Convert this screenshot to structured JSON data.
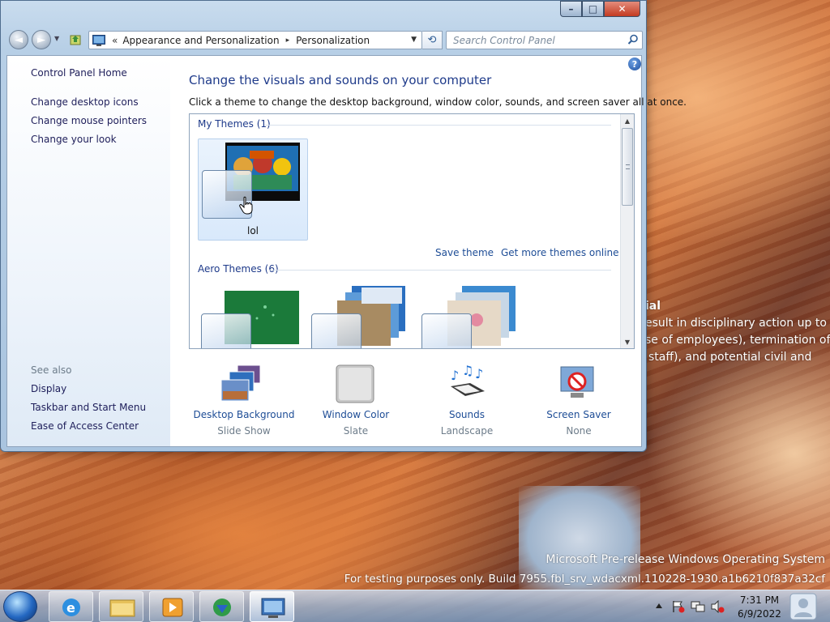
{
  "desktop": {
    "overlay_text": {
      "line1": "ial",
      "line2": "esult in disciplinary action up to",
      "line3": "se of employees), termination of",
      "line4": "staff), and potential civil and"
    },
    "watermark": {
      "line1": "Microsoft Pre-release Windows Operating System",
      "line2": "For testing purposes only. Build 7955.fbl_srv_wdacxml.110228-1930.a1b6210f837a32cf"
    }
  },
  "window": {
    "caption_buttons": {
      "minimize": "–",
      "maximize": "□",
      "close": "✕"
    },
    "nav": {
      "back": "◄",
      "forward": "►",
      "address": {
        "chevron": "«",
        "crumb1": "Appearance and Personalization",
        "separator": "▸",
        "crumb2": "Personalization",
        "dropdown": "▼"
      },
      "refresh": "⟲",
      "search": {
        "placeholder": "Search Control Panel"
      }
    },
    "left_pane": {
      "home": "Control Panel Home",
      "links": [
        "Change desktop icons",
        "Change mouse pointers",
        "Change your look"
      ],
      "see_also_label": "See also",
      "see_also": [
        "Display",
        "Taskbar and Start Menu",
        "Ease of Access Center"
      ]
    },
    "help": "?",
    "main": {
      "title": "Change the visuals and sounds on your computer",
      "subtitle": "Click a theme to change the desktop background, window color, sounds, and screen saver all at once.",
      "my_themes_header": "My Themes (1)",
      "my_theme_name": "lol",
      "save_theme": "Save theme",
      "get_more_themes": "Get more themes online",
      "aero_themes_header": "Aero Themes (6)"
    },
    "bottom": [
      {
        "label": "Desktop Background",
        "value": "Slide Show"
      },
      {
        "label": "Window Color",
        "value": "Slate"
      },
      {
        "label": "Sounds",
        "value": "Landscape"
      },
      {
        "label": "Screen Saver",
        "value": "None"
      }
    ]
  },
  "taskbar": {
    "clock": {
      "time": "7:31 PM",
      "date": "6/9/2022"
    },
    "tray_arrow": "▲"
  },
  "colors": {
    "link": "#1e4d96",
    "header": "#1e3a8a"
  }
}
